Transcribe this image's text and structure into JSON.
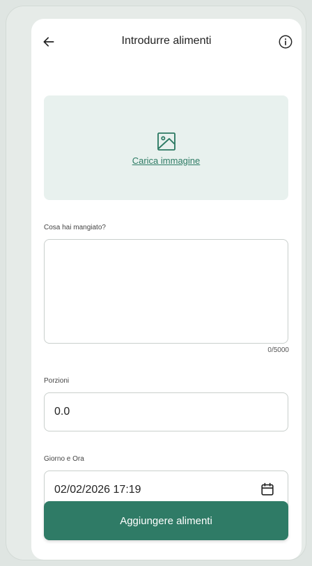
{
  "header": {
    "title": "Introdurre alimenti"
  },
  "upload": {
    "link_label": "Carica immagine"
  },
  "food_field": {
    "label": "Cosa hai mangiato?",
    "value": "",
    "counter": "0/5000"
  },
  "portions_field": {
    "label": "Porzioni",
    "value": "0.0"
  },
  "datetime_field": {
    "label": "Giorno e Ora",
    "value": "02/02/2026 17:19"
  },
  "submit": {
    "label": "Aggiungere alimenti"
  },
  "colors": {
    "accent": "#2f7b66",
    "upload_bg": "#e8f1ee"
  }
}
